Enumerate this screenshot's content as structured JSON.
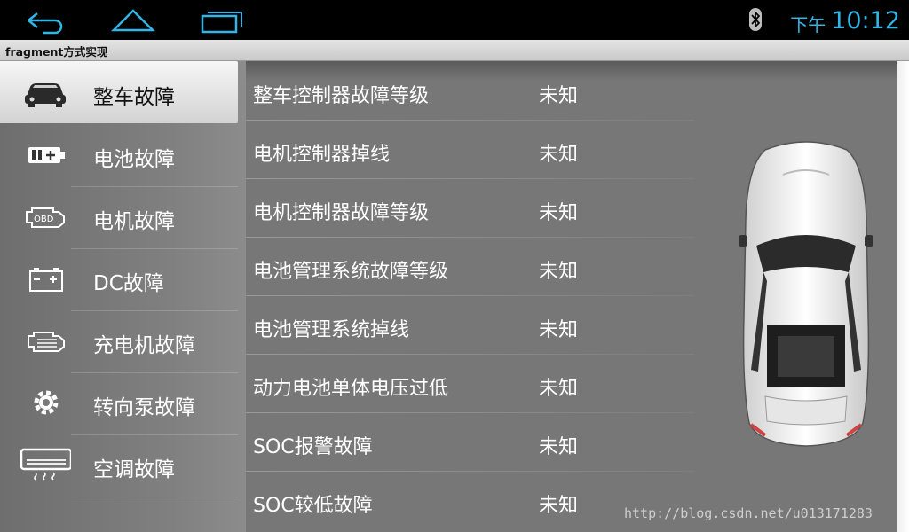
{
  "status_bar": {
    "nav_icons": [
      "back-icon",
      "home-icon",
      "recent-apps-icon"
    ],
    "bluetooth_icon": "bluetooth-icon",
    "ampm": "下午",
    "time": "10:12",
    "accent_color": "#33b5e5"
  },
  "app": {
    "title": "fragment方式实现"
  },
  "sidebar": {
    "items": [
      {
        "label": "整车故障",
        "icon": "car-icon",
        "active": true
      },
      {
        "label": "电池故障",
        "icon": "battery-icon",
        "active": false
      },
      {
        "label": "电机故障",
        "icon": "motor-obd-icon",
        "active": false
      },
      {
        "label": "DC故障",
        "icon": "dc-battery-icon",
        "active": false
      },
      {
        "label": "充电机故障",
        "icon": "charger-engine-icon",
        "active": false
      },
      {
        "label": "转向泵故障",
        "icon": "steering-pump-gear-icon",
        "active": false
      },
      {
        "label": "空调故障",
        "icon": "air-conditioner-icon",
        "active": false
      }
    ]
  },
  "faults": [
    {
      "name": "整车控制器故障等级",
      "status": "未知"
    },
    {
      "name": "电机控制器掉线",
      "status": "未知"
    },
    {
      "name": "电机控制器故障等级",
      "status": "未知"
    },
    {
      "name": "电池管理系统故障等级",
      "status": "未知"
    },
    {
      "name": "电池管理系统掉线",
      "status": "未知"
    },
    {
      "name": "动力电池单体电压过低",
      "status": "未知"
    },
    {
      "name": "SOC报警故障",
      "status": "未知"
    },
    {
      "name": "SOC较低故障",
      "status": "未知"
    }
  ],
  "watermark": "http://blog.csdn.net/u013171283"
}
